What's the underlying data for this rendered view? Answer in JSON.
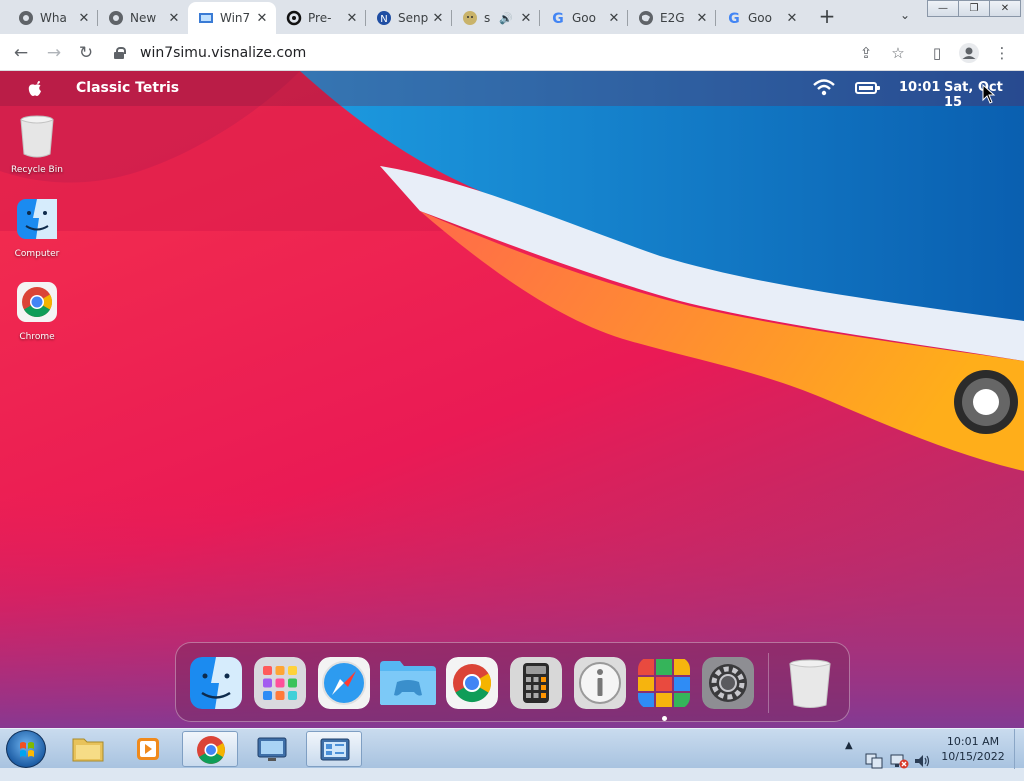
{
  "browser": {
    "tabs": [
      {
        "title": "Wha",
        "icon": "chrome-icon"
      },
      {
        "title": "New",
        "icon": "chrome-icon"
      },
      {
        "title": "Win7",
        "icon": "win7-icon",
        "active": true
      },
      {
        "title": "Pre-",
        "icon": "threads-icon"
      },
      {
        "title": "Senp",
        "icon": "senpai-icon"
      },
      {
        "title": "s",
        "icon": "smiley-icon",
        "audio": true
      },
      {
        "title": "Goo",
        "icon": "google-icon"
      },
      {
        "title": "E2G",
        "icon": "globe-icon"
      },
      {
        "title": "Goo",
        "icon": "google-icon"
      }
    ],
    "url": "win7simu.visnalize.com"
  },
  "desktop": {
    "menubar": {
      "app_name": "Classic Tetris",
      "time": "10:01",
      "date": "Sat, Oct 15"
    },
    "icons": [
      {
        "label": "Recycle Bin"
      },
      {
        "label": "Computer"
      },
      {
        "label": "Chrome"
      }
    ],
    "dock": [
      {
        "name": "finder"
      },
      {
        "name": "launchpad"
      },
      {
        "name": "safari"
      },
      {
        "name": "games-folder"
      },
      {
        "name": "chrome"
      },
      {
        "name": "calculator"
      },
      {
        "name": "info"
      },
      {
        "name": "mosaic-app"
      },
      {
        "name": "system-preferences"
      },
      {
        "name": "trash"
      }
    ]
  },
  "taskbar": {
    "time": "10:01 AM",
    "date": "10/15/2022"
  }
}
